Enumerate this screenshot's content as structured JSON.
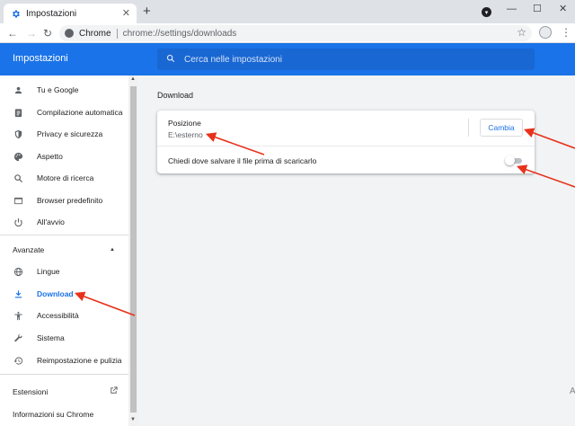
{
  "browser": {
    "tab_title": "Impostazioni",
    "tab_close": "✕",
    "new_tab": "+",
    "window_controls": {
      "minimize": "—",
      "maximize": "☐",
      "close": "✕"
    },
    "nav": {
      "back": "←",
      "forward": "→",
      "reload": "↻"
    },
    "omnibox": {
      "site_label": "Chrome",
      "url": "chrome://settings/downloads"
    },
    "star": "☆",
    "menu": "⋮"
  },
  "settings": {
    "title": "Impostazioni",
    "search_placeholder": "Cerca nelle impostazioni"
  },
  "sidebar": {
    "items": [
      {
        "label": "Tu e Google",
        "icon": "person-icon"
      },
      {
        "label": "Compilazione automatica",
        "icon": "clipboard-icon"
      },
      {
        "label": "Privacy e sicurezza",
        "icon": "shield-icon"
      },
      {
        "label": "Aspetto",
        "icon": "palette-icon"
      },
      {
        "label": "Motore di ricerca",
        "icon": "search-icon"
      },
      {
        "label": "Browser predefinito",
        "icon": "browser-icon"
      },
      {
        "label": "All'avvio",
        "icon": "power-icon"
      }
    ],
    "advanced_label": "Avanzate",
    "advanced_caret": "▲",
    "advanced_items": [
      {
        "label": "Lingue",
        "icon": "globe-icon"
      },
      {
        "label": "Download",
        "icon": "download-icon",
        "active": true
      },
      {
        "label": "Accessibilità",
        "icon": "accessibility-icon"
      },
      {
        "label": "Sistema",
        "icon": "wrench-icon"
      },
      {
        "label": "Reimpostazione e pulizia",
        "icon": "restore-icon"
      }
    ],
    "extensions_label": "Estensioni",
    "about_label": "Informazioni su Chrome"
  },
  "main": {
    "heading": "Download",
    "location_label": "Posizione",
    "location_value": "E:\\esterno",
    "change_button": "Cambia",
    "ask_label": "Chiedi dove salvare il file prima di scaricarlo",
    "ask_enabled": false
  },
  "corner_text": "A",
  "colors": {
    "accent": "#1a73e8",
    "annotation": "#e8311a"
  }
}
